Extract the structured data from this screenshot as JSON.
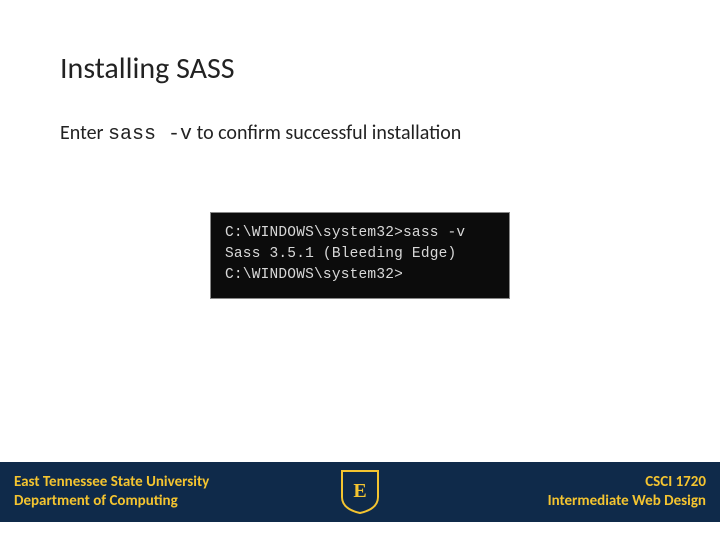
{
  "title": "Installing SASS",
  "instruction": {
    "prefix": "Enter ",
    "command": "sass -v",
    "suffix": " to confirm successful installation"
  },
  "terminal": {
    "line1": "C:\\WINDOWS\\system32>sass -v",
    "line2": "Sass 3.5.1 (Bleeding Edge)",
    "blank": "",
    "line3": "C:\\WINDOWS\\system32>"
  },
  "footer": {
    "university": "East Tennessee State University",
    "department": "Department of Computing",
    "course_code": "CSCI 1720",
    "course_name": "Intermediate Web Design"
  },
  "colors": {
    "footer_bg": "#0f2a4a",
    "gold": "#f4c430",
    "terminal_bg": "#0c0c0c"
  }
}
